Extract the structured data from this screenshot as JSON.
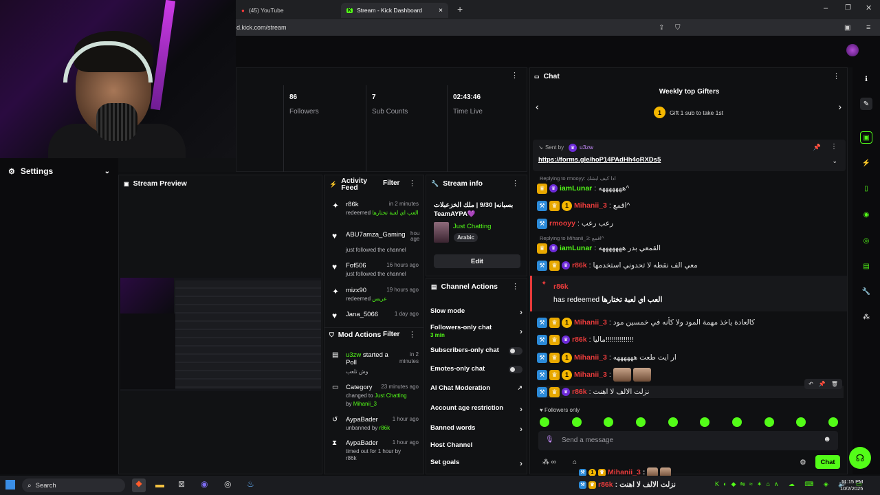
{
  "browser": {
    "tabs": [
      {
        "title": "(45) YouTube"
      },
      {
        "title": "Stream - Kick Dashboard"
      }
    ],
    "url": "d.kick.com/stream"
  },
  "left": {
    "settings_label": "Settings"
  },
  "stats": [
    {
      "value": "86",
      "label": "Followers"
    },
    {
      "value": "7",
      "label": "Sub Counts"
    },
    {
      "value": "02:43:46",
      "label": "Time Live"
    }
  ],
  "preview": {
    "title": "Stream Preview"
  },
  "activity": {
    "title_line1": "Activity",
    "title_line2": "Feed",
    "filter": "Filter",
    "items": [
      {
        "icon": "redeem-icon",
        "name": "r86k",
        "time": "in 2 minutes",
        "desc": "redeemed",
        "desc2": "العب اي لعبة تختارها"
      },
      {
        "icon": "heart-icon",
        "name": "ABU7amza_Gaming",
        "time": "hou age",
        "desc": "just followed the channel",
        "desc2": ""
      },
      {
        "icon": "heart-icon",
        "name": "Fof506",
        "time": "16 hours ago",
        "desc": "just followed the channel",
        "desc2": ""
      },
      {
        "icon": "redeem-icon",
        "name": "mizx90",
        "time": "19 hours ago",
        "desc": "redeemed",
        "desc2": "عريس"
      },
      {
        "icon": "heart-icon",
        "name": "Jana_5066",
        "time": "1 day ago",
        "desc": "",
        "desc2": ""
      }
    ]
  },
  "mod_actions": {
    "title": "Mod Actions",
    "filter": "Filter",
    "items": [
      {
        "name": "u3zw",
        "action": "started a Poll",
        "time": "in 2 minutes",
        "extra": "وش تلعب"
      },
      {
        "name": "Category",
        "action": "",
        "time": "23 minutes ago",
        "extra": "changed to",
        "extra2": "Just Chatting",
        "by": "by",
        "byname": "Mihanii_3"
      },
      {
        "name": "AypaBader",
        "action": "",
        "time": "1 hour ago",
        "extra": "unbanned by",
        "extra2": "r86k"
      },
      {
        "name": "AypaBader",
        "action": "",
        "time": "1 hour ago",
        "extra": "timed out for 1 hour by",
        "extra2": "r86k"
      }
    ]
  },
  "stream_info": {
    "title": "Stream info",
    "stream_title": "بسبانه| 9/30 | ملك الخزعبلات",
    "stream_title2": "TeamAYPA💜",
    "category": "Just Chatting",
    "language": "Arabic",
    "edit": "Edit"
  },
  "channel_actions": {
    "title": "Channel Actions",
    "items": [
      {
        "label": "Slow mode",
        "kind": "chevron"
      },
      {
        "label": "Followers-only chat",
        "sub": "3 min",
        "kind": "chevron"
      },
      {
        "label": "Subscribers-only chat",
        "kind": "toggle"
      },
      {
        "label": "Emotes-only chat",
        "kind": "toggle"
      },
      {
        "label": "AI Chat Moderation",
        "kind": "external"
      },
      {
        "label": "Account age restriction",
        "kind": "chevron"
      },
      {
        "label": "Banned words",
        "kind": "chevron"
      },
      {
        "label": "Host Channel",
        "kind": "none"
      },
      {
        "label": "Set goals",
        "kind": "chevron"
      }
    ]
  },
  "chat": {
    "title": "Chat",
    "gifters_title": "Weekly top Gifters",
    "gifters_rank": "1",
    "gifters_text": "Gift 1 sub to take 1st",
    "pinned_sent_by": "Sent by",
    "pinned_user": "u3zw",
    "pinned_link": "https://forms.gle/hoP14PAdHh4oRXDs5",
    "followers_only": "Followers only",
    "send_placeholder": "Send a message",
    "send_button": "Chat",
    "messages": [
      {
        "reply": "Replying to rmooyy: اذا كيف ابشك",
        "user": "iamLunar",
        "color": "#53fc18",
        "text": "هههههههه^"
      },
      {
        "reply": "",
        "user": "Mihanii_3",
        "color": "#e83b3b",
        "text": "اقمع^"
      },
      {
        "reply": "",
        "user": "rmooyy",
        "color": "#e83b3b",
        "text": "رعب رعب"
      },
      {
        "reply": "Replying to Mihanii_3: اقمع^",
        "user": "iamLunar",
        "color": "#53fc18",
        "text": "القمعي بدر هههههههه"
      },
      {
        "reply": "",
        "user": "r86k",
        "color": "#e83b3b",
        "text": "معي الف نقطه لا تحدوني استخدمها"
      },
      {
        "reply": "",
        "user": "Mihanii_3",
        "color": "#e83b3b",
        "text": "كالعادة ياخذ مهمة المود ولا كأنه في خمسين مود"
      },
      {
        "reply": "",
        "user": "r86k",
        "color": "#e83b3b",
        "text": "ماليا!!!!!!!!!!!!!!"
      },
      {
        "reply": "",
        "user": "Mihanii_3",
        "color": "#e83b3b",
        "text": "ار ايت طعت ههههههه"
      },
      {
        "reply": "",
        "user": "Mihanii_3",
        "color": "#e83b3b",
        "text": ""
      },
      {
        "reply": "",
        "user": "r86k",
        "color": "#e83b3b",
        "text": "نزلت الالف لا اهنت"
      }
    ],
    "redeem": {
      "user": "r86k",
      "text": "has redeemed",
      "reward": "العب اي لعبة تختارها"
    }
  },
  "overlay_chat": [
    {
      "user": "Mihanii_3",
      "text": ""
    },
    {
      "user": "r86k",
      "text": "نزلت الالف لا اهنت"
    }
  ],
  "taskbar": {
    "search": "Search",
    "time": "11:15 PM",
    "date": "10/2/2025"
  }
}
